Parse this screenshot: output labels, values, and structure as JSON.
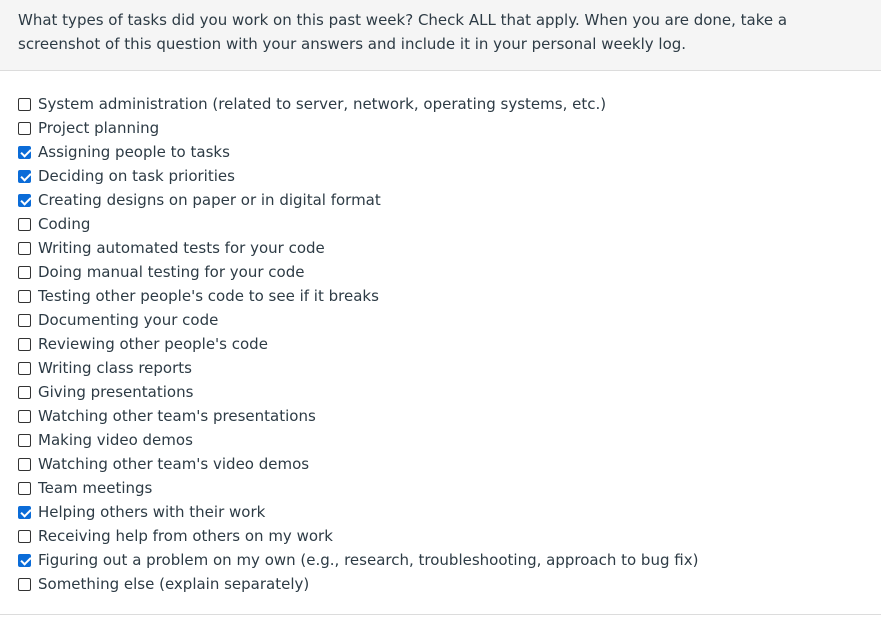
{
  "question": {
    "text": "What types of tasks did you work on this past week? Check ALL that apply. When you are done, take a screenshot of this question with your answers and include it in your personal weekly log."
  },
  "answers": [
    {
      "label": "System administration (related to server, network, operating systems, etc.)",
      "checked": false
    },
    {
      "label": "Project planning",
      "checked": false
    },
    {
      "label": "Assigning people to tasks",
      "checked": true
    },
    {
      "label": "Deciding on task priorities",
      "checked": true
    },
    {
      "label": "Creating designs on paper or in digital format",
      "checked": true
    },
    {
      "label": "Coding",
      "checked": false
    },
    {
      "label": "Writing automated tests for your code",
      "checked": false
    },
    {
      "label": "Doing manual testing for your code",
      "checked": false
    },
    {
      "label": "Testing other people's code to see if it breaks",
      "checked": false
    },
    {
      "label": "Documenting your code",
      "checked": false
    },
    {
      "label": "Reviewing other people's code",
      "checked": false
    },
    {
      "label": "Writing class reports",
      "checked": false
    },
    {
      "label": "Giving presentations",
      "checked": false
    },
    {
      "label": "Watching other team's presentations",
      "checked": false
    },
    {
      "label": "Making video demos",
      "checked": false
    },
    {
      "label": "Watching other team's video demos",
      "checked": false
    },
    {
      "label": "Team meetings",
      "checked": false
    },
    {
      "label": "Helping others with their work",
      "checked": true
    },
    {
      "label": "Receiving help from others on my work",
      "checked": false
    },
    {
      "label": "Figuring out a problem on my own (e.g., research, troubleshooting, approach to bug fix)",
      "checked": true
    },
    {
      "label": "Something else (explain separately)",
      "checked": false
    }
  ],
  "colors": {
    "checked": "#0b6cd8",
    "header_bg": "#f5f5f5",
    "text": "#2d3b45"
  }
}
